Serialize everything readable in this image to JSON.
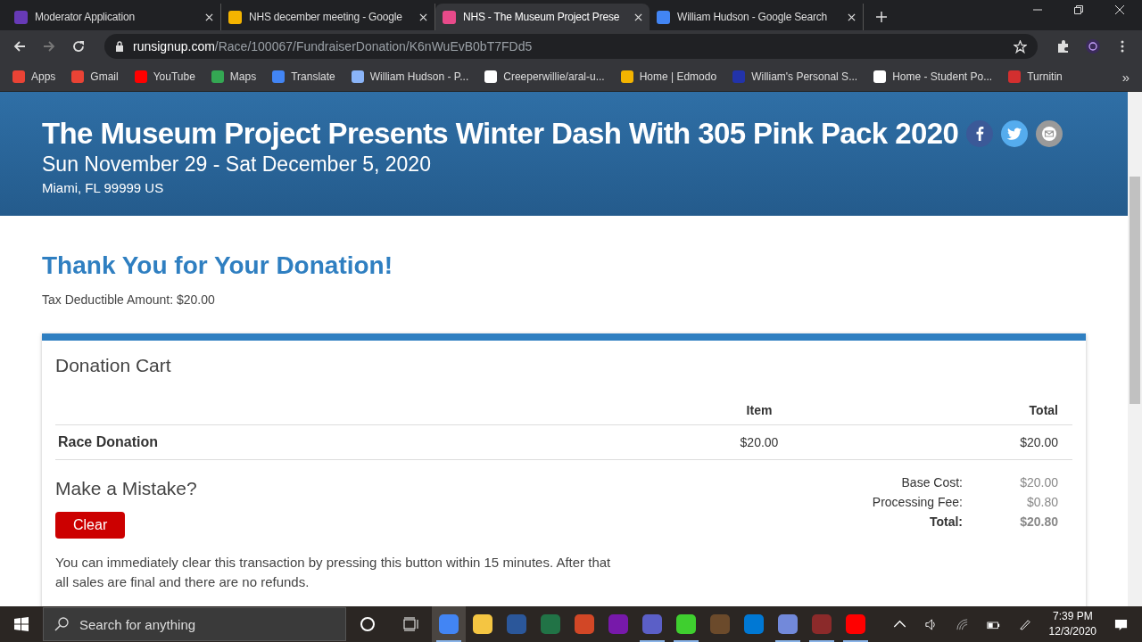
{
  "browser": {
    "tabs": [
      {
        "title": "Moderator Application",
        "color": "#673ab7",
        "selected": false
      },
      {
        "title": "NHS december meeting - Google",
        "color": "#f4b400",
        "selected": false
      },
      {
        "title": "NHS - The Museum Project Prese",
        "color": "#e84a8a",
        "selected": true
      },
      {
        "title": "William Hudson - Google Search",
        "color": "#4285f4",
        "selected": false
      }
    ],
    "url_host": "runsignup.com",
    "url_path": "/Race/100067/FundraiserDonation/K6nWuEvB0bT7FDd5",
    "bookmarks": [
      {
        "label": "Apps",
        "color": "#ea4335"
      },
      {
        "label": "Gmail",
        "color": "#ea4335"
      },
      {
        "label": "YouTube",
        "color": "#ff0000"
      },
      {
        "label": "Maps",
        "color": "#34a853"
      },
      {
        "label": "Translate",
        "color": "#4285f4"
      },
      {
        "label": "William Hudson - P...",
        "color": "#8ab4f8"
      },
      {
        "label": "Creeperwillie/aral-u...",
        "color": "#ffffff"
      },
      {
        "label": "Home | Edmodo",
        "color": "#f4b400"
      },
      {
        "label": "William's Personal S...",
        "color": "#2233aa"
      },
      {
        "label": "Home - Student Po...",
        "color": "#ffffff"
      },
      {
        "label": "Turnitin",
        "color": "#d32f2f"
      }
    ],
    "more": "»"
  },
  "event": {
    "title": "The Museum Project Presents Winter Dash With 305 Pink Pack 2020",
    "dates": "Sun November 29 - Sat December 5, 2020",
    "location": "Miami, FL 99999 US"
  },
  "thanks": {
    "heading": "Thank You for Your Donation!",
    "tax": "Tax Deductible Amount: $20.00"
  },
  "cart": {
    "title": "Donation Cart",
    "columns": [
      "Item",
      "Total"
    ],
    "rows": [
      {
        "name": "Race Donation",
        "item": "$20.00",
        "total": "$20.00"
      }
    ],
    "summary": [
      {
        "label": "Base Cost:",
        "value": "$20.00",
        "bold": false
      },
      {
        "label": "Processing Fee:",
        "value": "$0.80",
        "bold": false
      },
      {
        "label": "Total:",
        "value": "$20.80",
        "bold": true
      }
    ],
    "mistake_heading": "Make a Mistake?",
    "clear_button": "Clear",
    "notice": "You can immediately clear this transaction by pressing this button within 15 minutes. After that all sales are final and there are no refunds."
  },
  "taskbar": {
    "search_placeholder": "Search for anything",
    "apps": [
      {
        "color": "#4285f4",
        "running": true,
        "selected": true
      },
      {
        "color": "#f4c542",
        "running": false,
        "selected": false
      },
      {
        "color": "#2b579a",
        "running": false,
        "selected": false
      },
      {
        "color": "#217346",
        "running": false,
        "selected": false
      },
      {
        "color": "#d24726",
        "running": false,
        "selected": false
      },
      {
        "color": "#7719aa",
        "running": false,
        "selected": false
      },
      {
        "color": "#5b5fc7",
        "running": true,
        "selected": false
      },
      {
        "color": "#3fcf2f",
        "running": true,
        "selected": false
      },
      {
        "color": "#6b4a2b",
        "running": false,
        "selected": false
      },
      {
        "color": "#0078d4",
        "running": false,
        "selected": false
      },
      {
        "color": "#7289da",
        "running": true,
        "selected": false
      },
      {
        "color": "#8b2a2a",
        "running": true,
        "selected": false
      },
      {
        "color": "#ff0000",
        "running": true,
        "selected": false
      }
    ],
    "time": "7:39 PM",
    "date": "12/3/2020"
  }
}
